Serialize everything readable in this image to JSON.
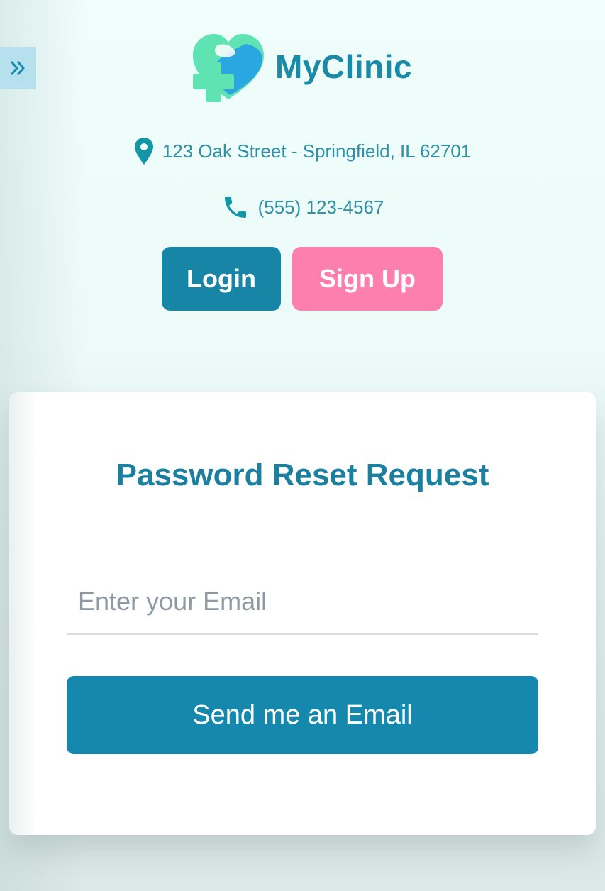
{
  "sidebar_toggle": {
    "icon": "double-chevron-right-icon"
  },
  "brand": {
    "name": "MyClinic",
    "logo_icon": "heart-medical-cross-icon"
  },
  "contact": {
    "address_icon": "location-pin-icon",
    "address": "123 Oak Street - Springfield, IL 62701",
    "phone_icon": "phone-icon",
    "phone": "(555) 123-4567"
  },
  "auth": {
    "login_label": "Login",
    "signup_label": "Sign Up"
  },
  "reset_form": {
    "title": "Password Reset Request",
    "email_placeholder": "Enter your Email",
    "email_value": "",
    "submit_label": "Send me an Email"
  },
  "colors": {
    "primary": "#1786a6",
    "accent_pink": "#fd7fad",
    "logo_green": "#5fe3b2",
    "logo_blue": "#2aa6e0",
    "background": "#effdfb"
  }
}
